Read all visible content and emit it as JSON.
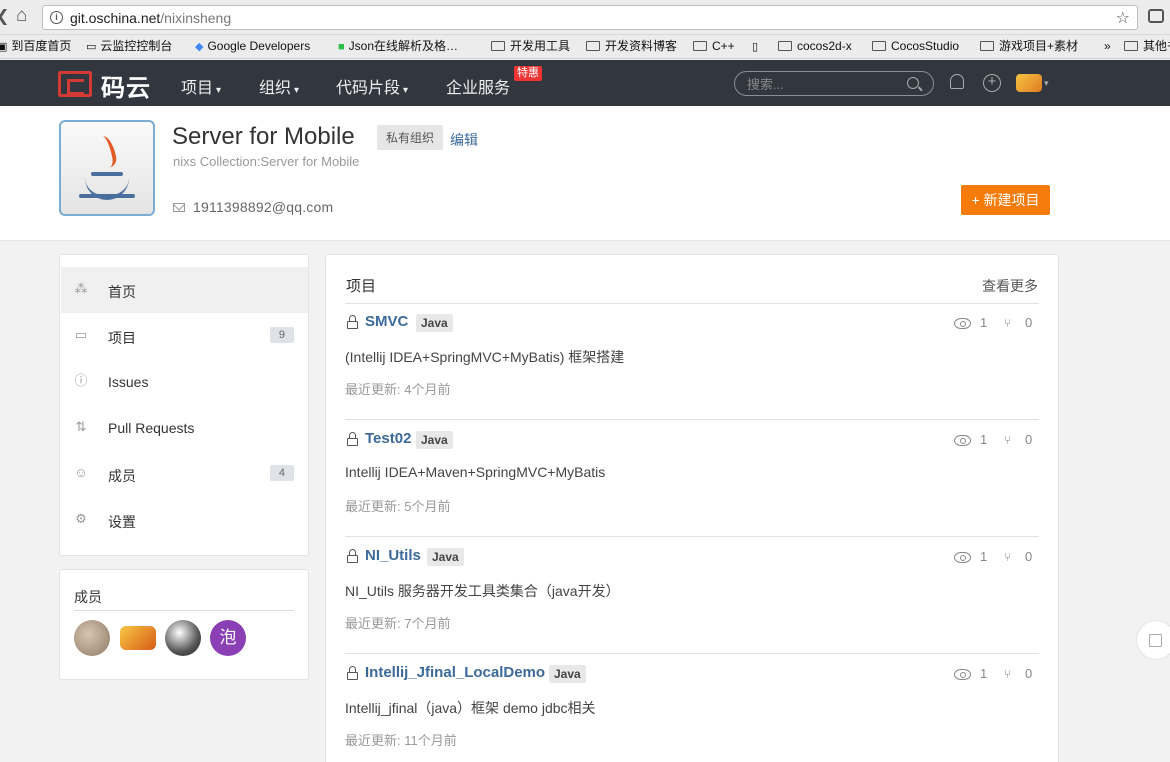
{
  "browser": {
    "back_glyph": "❮",
    "home_glyph": "⌂",
    "url_host": "git.oschina.net",
    "url_path": "/nixinsheng",
    "star_glyph": "☆",
    "bookmarks": [
      {
        "label": "到百度首页",
        "type": "page"
      },
      {
        "label": "云监控控制台",
        "type": "page"
      },
      {
        "label": "Google Developers",
        "type": "page"
      },
      {
        "label": "Json在线解析及格…",
        "type": "page"
      },
      {
        "label": "开发用工具",
        "type": "folder"
      },
      {
        "label": "开发资料博客",
        "type": "folder"
      },
      {
        "label": "C++",
        "type": "folder"
      },
      {
        "label": "",
        "type": "page"
      },
      {
        "label": "cocos2d-x",
        "type": "folder"
      },
      {
        "label": "CocosStudio",
        "type": "folder"
      },
      {
        "label": "游戏项目+素材",
        "type": "folder"
      },
      {
        "label": "»",
        "type": "more"
      },
      {
        "label": "其他书签",
        "type": "folder"
      }
    ]
  },
  "header": {
    "logo_text": "码云",
    "nav": [
      {
        "label": "项目",
        "caret": "▾"
      },
      {
        "label": "组织",
        "caret": "▾"
      },
      {
        "label": "代码片段",
        "caret": "▾"
      },
      {
        "label": "企业服务",
        "caret": ""
      }
    ],
    "nav_badge": "特惠",
    "search_placeholder": "搜索...",
    "plus_glyph": "+",
    "avatar_caret": "▾"
  },
  "group": {
    "title": "Server for Mobile",
    "private_badge": "私有组织",
    "edit_label": "编辑",
    "subtitle": "nixs Collection:Server for Mobile",
    "email": "1911398892@qq.com",
    "new_project_label": "+ 新建项目"
  },
  "sidebar": {
    "items": [
      {
        "label": "首页",
        "icon": "home-icon",
        "glyph": "⁂",
        "count": ""
      },
      {
        "label": "项目",
        "icon": "repo-icon",
        "glyph": "▭",
        "count": "9"
      },
      {
        "label": "Issues",
        "icon": "issue-icon",
        "glyph": "ⓘ",
        "count": ""
      },
      {
        "label": "Pull Requests",
        "icon": "pull-request-icon",
        "glyph": "⇅",
        "count": ""
      },
      {
        "label": "成员",
        "icon": "members-icon",
        "glyph": "☺",
        "count": "4"
      },
      {
        "label": "设置",
        "icon": "settings-icon",
        "glyph": "⚙",
        "count": ""
      }
    ]
  },
  "members": {
    "title": "成员",
    "avatars": [
      {
        "kind": "photo"
      },
      {
        "kind": "cartoon"
      },
      {
        "kind": "apple-logo"
      },
      {
        "kind": "letter",
        "letter": "泡"
      }
    ]
  },
  "projects": {
    "title": "项目",
    "view_more": "查看更多",
    "items": [
      {
        "name": "SMVC",
        "lang": "Java",
        "watchers": "1",
        "forks": "0",
        "desc": "(Intellij IDEA+SpringMVC+MyBatis) 框架搭建",
        "updated": "最近更新: 4个月前"
      },
      {
        "name": "Test02",
        "lang": "Java",
        "watchers": "1",
        "forks": "0",
        "desc": "Intellij IDEA+Maven+SpringMVC+MyBatis",
        "updated": "最近更新: 5个月前"
      },
      {
        "name": "NI_Utils",
        "lang": "Java",
        "watchers": "1",
        "forks": "0",
        "desc": "NI_Utils 服务器开发工具类集合（java开发）",
        "updated": "最近更新: 7个月前"
      },
      {
        "name": "Intellij_Jfinal_LocalDemo",
        "lang": "Java",
        "watchers": "1",
        "forks": "0",
        "desc": "Intellij_jfinal（java）框架 demo jdbc相关",
        "updated": "最近更新: 11个月前"
      }
    ],
    "fork_glyph": "⑂"
  }
}
